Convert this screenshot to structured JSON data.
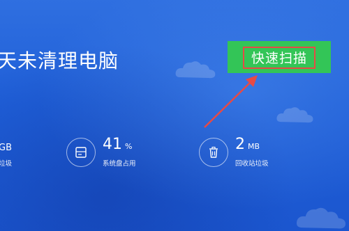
{
  "headline": "天未清理电脑",
  "scan_button": {
    "label": "快速扫描"
  },
  "stats": [
    {
      "value": "GB",
      "unit": "",
      "caption": "垃圾",
      "icon": "trash-partial",
      "partial": true
    },
    {
      "value": "41",
      "unit": "%",
      "caption": "系统盘占用",
      "icon": "disk-icon"
    },
    {
      "value": "2",
      "unit": "MB",
      "caption": "回收站垃圾",
      "icon": "recycle-bin-icon"
    }
  ],
  "colors": {
    "background": "#1f5fd8",
    "button": "#33c557",
    "highlight": "#e74a45"
  }
}
